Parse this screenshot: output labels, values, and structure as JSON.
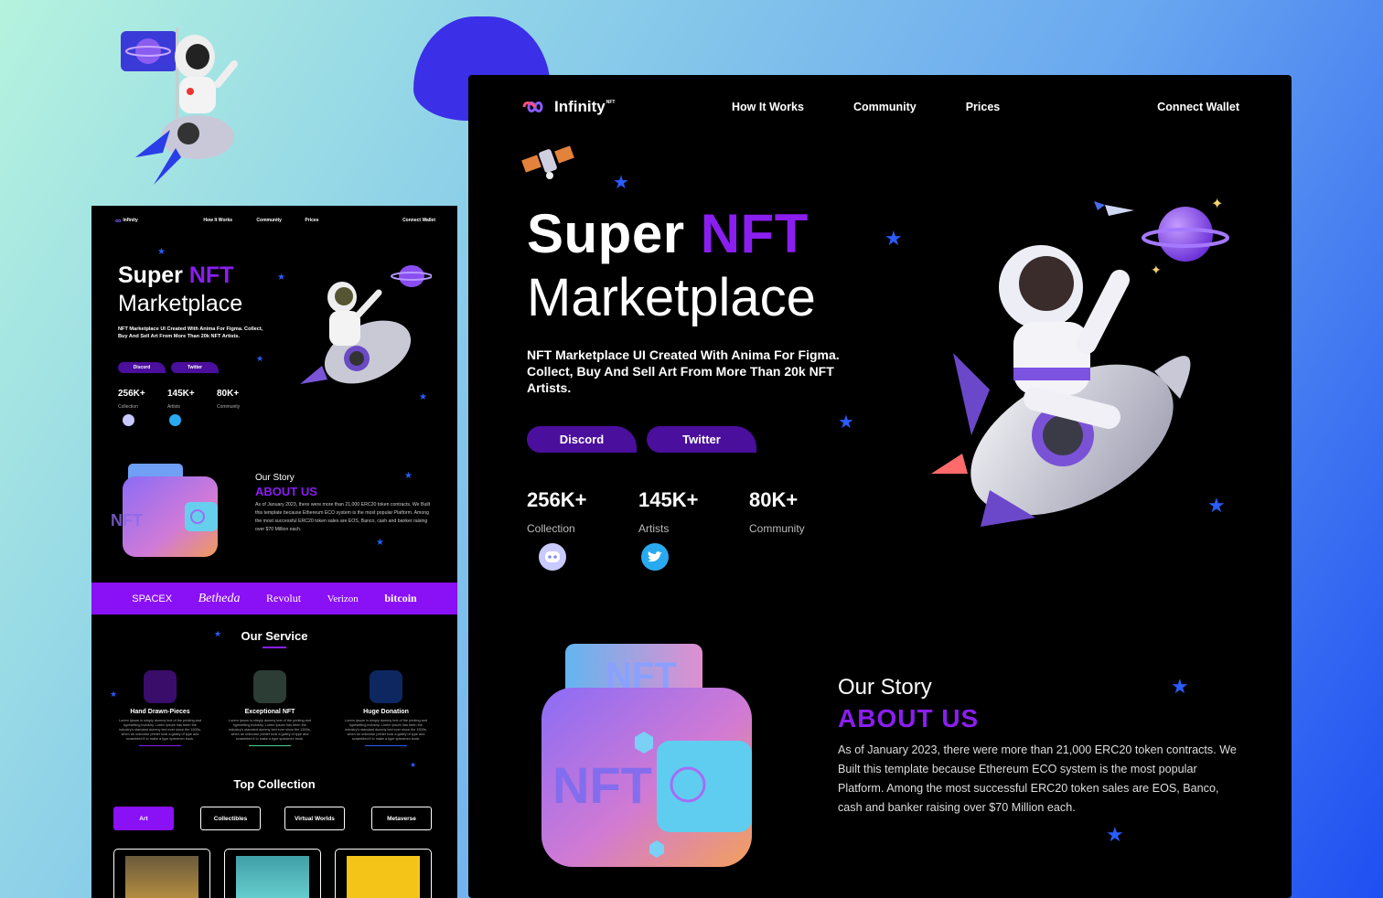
{
  "brand": {
    "name": "Infinity",
    "badge": "NFT"
  },
  "nav": {
    "links": [
      "How It Works",
      "Community",
      "Prices"
    ],
    "connect": "Connect Wallet"
  },
  "hero": {
    "title_white": "Super",
    "title_purple": "NFT",
    "title_line2": "Marketplace",
    "subtitle": "NFT Marketplace UI Created With Anima For Figma. Collect, Buy And Sell Art From More Than 20k NFT Artists.",
    "buttons": [
      "Discord",
      "Twitter"
    ],
    "stats": [
      {
        "value": "256K+",
        "label": "Collection"
      },
      {
        "value": "145K+",
        "label": "Artists"
      },
      {
        "value": "80K+",
        "label": "Community"
      }
    ]
  },
  "story": {
    "kicker": "Our Story",
    "title": "ABOUT US",
    "text": "As of January 2023, there were more than 21,000 ERC20 token contracts. We Built this template because Ethereum ECO system is the most popular Platform. Among the most successful ERC20 token sales are EOS, Banco, cash and banker raising over $70 Million each."
  },
  "artwork_text": "NFT",
  "brands": [
    "SPACEX",
    "Betheda",
    "Revolut",
    "Verizon",
    "bitcoin"
  ],
  "service": {
    "title": "Our Service",
    "items": [
      {
        "title": "Hand Drawn-Pieces",
        "text": "Lorem Ipsum is simply dummy text of the printing and typesetting industry. Lorem Ipsum has been the industry's standard dummy text ever since the 1500s, when an unknown printer took a galley of type and scrambled it to make a type specimen book."
      },
      {
        "title": "Exceptional NFT",
        "text": "Lorem Ipsum is simply dummy text of the printing and typesetting industry. Lorem Ipsum has been the industry's standard dummy text ever since the 1500s, when an unknown printer took a galley of type and scrambled it to make a type specimen book."
      },
      {
        "title": "Huge Donation",
        "text": "Lorem Ipsum is simply dummy text of the printing and typesetting industry. Lorem Ipsum has been the industry's standard dummy text ever since the 1500s, when an unknown printer took a galley of type and scrambled it to make a type specimen book."
      }
    ]
  },
  "collection": {
    "title": "Top Collection",
    "tabs": [
      "Art",
      "Collectibles",
      "Virtual Worlds",
      "Metaverse"
    ]
  },
  "colors": {
    "accent": "#8a1ef0",
    "button": "#4b0f9d",
    "star": "#2a5cff",
    "brand_bar": "#8a10f6"
  }
}
